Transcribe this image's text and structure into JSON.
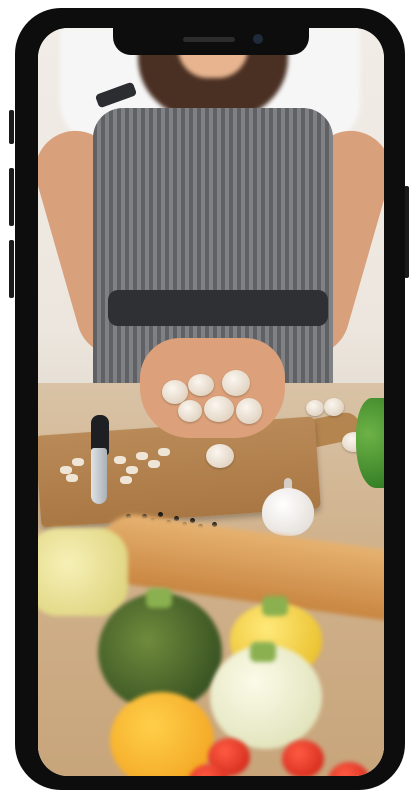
{
  "scene": {
    "subject": "",
    "accent_colors": {
      "frame": "#0d0d0d",
      "apron": "#6f7174",
      "board": "#b98a58",
      "counter": "#d0b28d"
    }
  }
}
